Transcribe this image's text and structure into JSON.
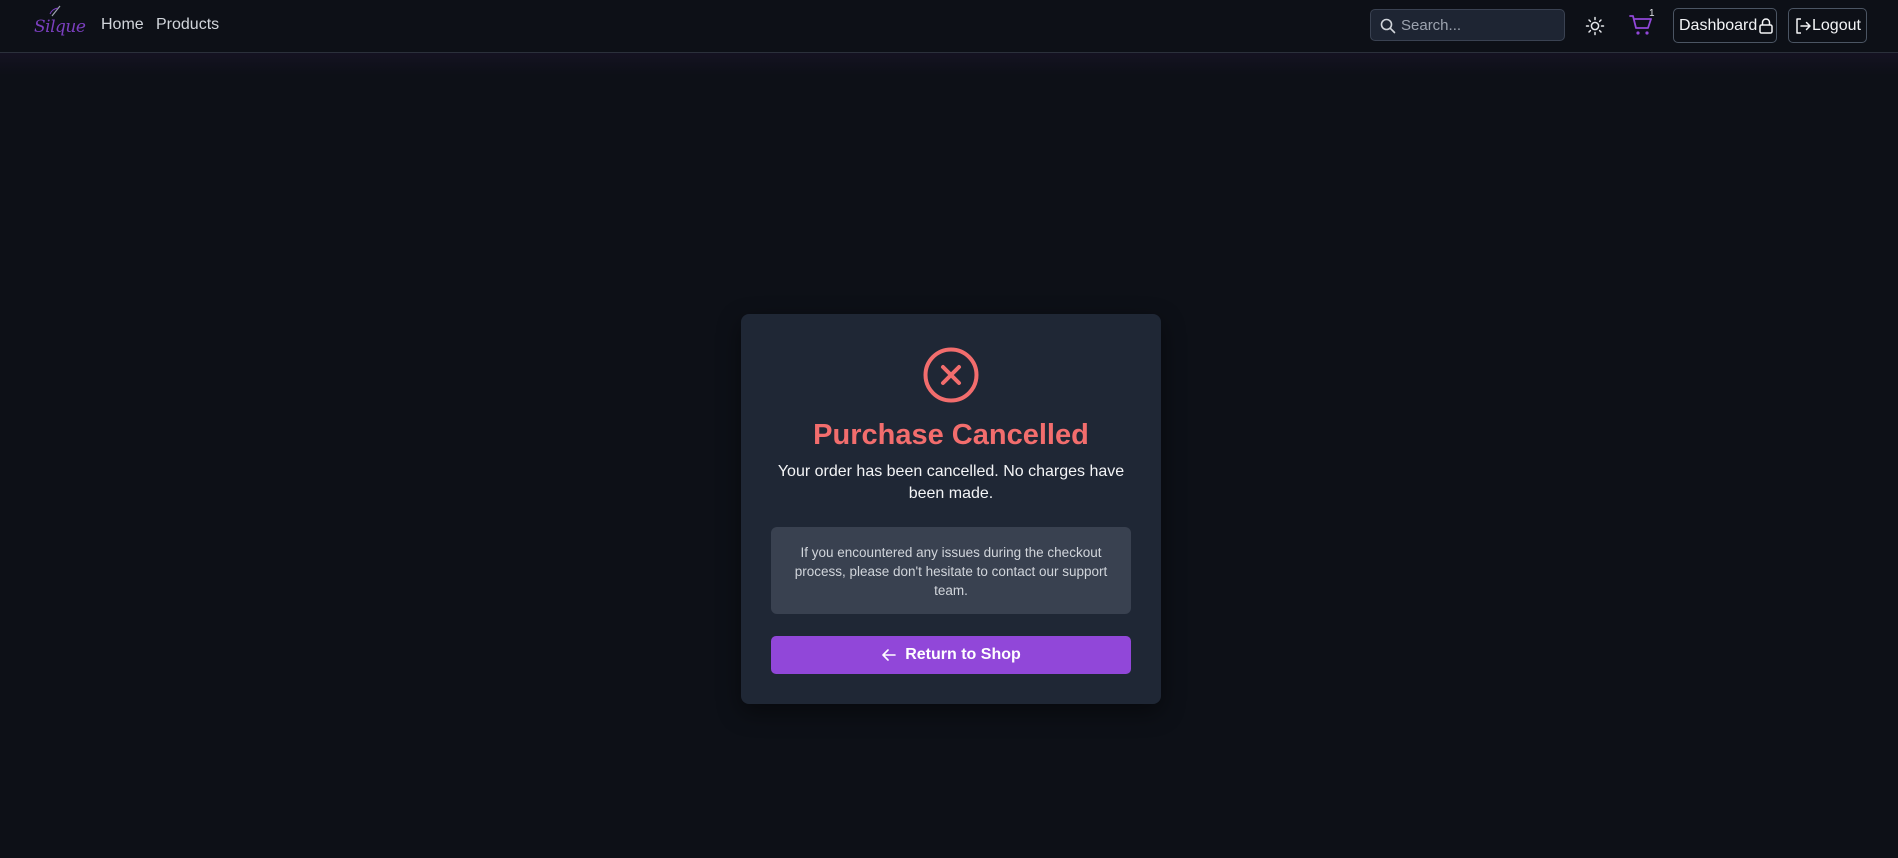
{
  "brand": {
    "logo_text": "Silque",
    "accent": "#9147d9"
  },
  "nav": {
    "links": [
      {
        "label": "Home"
      },
      {
        "label": "Products"
      }
    ]
  },
  "header": {
    "search_placeholder": "Search...",
    "theme_icon": "sun-icon",
    "cart_icon": "cart-icon",
    "cart_count": "1",
    "dashboard_label": "Dashboard",
    "dashboard_icon": "lock-icon",
    "logout_label": "Logout",
    "logout_icon": "logout-icon"
  },
  "card": {
    "status_icon": "x-circle-icon",
    "status_color": "#f26d6d",
    "title": "Purchase Cancelled",
    "message": "Your order has been cancelled. No charges have been made.",
    "note": "If you encountered any issues during the checkout process, please don't hesitate to contact our support team.",
    "button_label": "Return to Shop",
    "button_icon": "arrow-left-icon"
  }
}
